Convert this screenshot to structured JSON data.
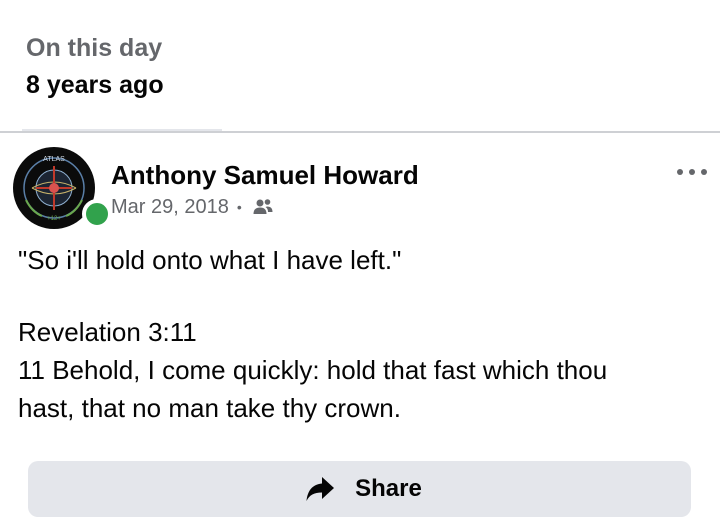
{
  "header": {
    "label": "On this day",
    "time_ago": "8 years ago"
  },
  "post": {
    "author": "Anthony Samuel Howard",
    "date": "Mar 29, 2018",
    "separator": "•",
    "audience_icon": "friends-icon",
    "online": true,
    "avatar_text_top": "ATLAS",
    "avatar_text_bottom": "+12+",
    "body": {
      "quote": "\"So i'll hold onto what I have left.\"",
      "reference": "Revelation 3:11",
      "verse_line1": "11 Behold, I come quickly: hold that fast which thou",
      "verse_line2": "hast, that no man take thy crown."
    }
  },
  "actions": {
    "share_label": "Share",
    "share_icon": "share-arrow-icon",
    "more_icon": "more-options-icon"
  },
  "colors": {
    "primary_text": "#050505",
    "secondary_text": "#65676b",
    "online_green": "#31a24c",
    "button_bg": "#e4e6eb"
  }
}
